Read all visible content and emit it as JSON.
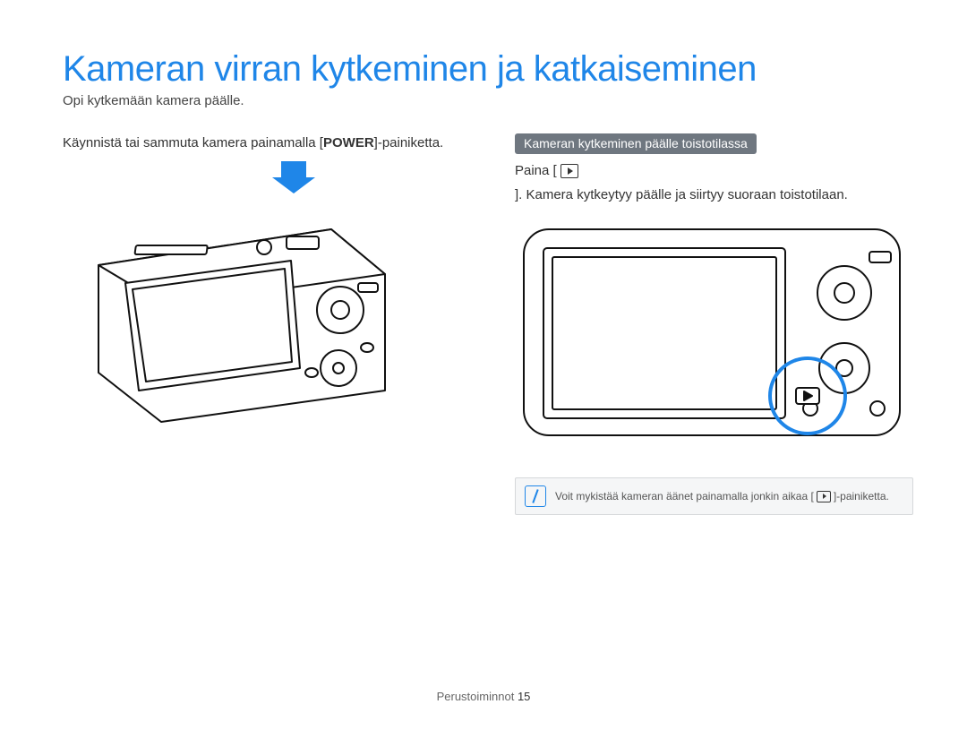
{
  "title": "Kameran virran kytkeminen ja katkaiseminen",
  "subtitle": "Opi kytkemään kamera päälle.",
  "left": {
    "instruction_pre": "Käynnistä tai sammuta kamera painamalla [",
    "power_label": "POWER",
    "instruction_post": "]-painiketta."
  },
  "right": {
    "pill": "Kameran kytkeminen päälle toistotilassa",
    "press_pre": "Paina [",
    "press_post": "]. Kamera kytkeytyy päälle ja siirtyy suoraan toistotilaan.",
    "note_pre": "Voit mykistää kameran äänet painamalla jonkin aikaa [",
    "note_post": "]-painiketta."
  },
  "footer": {
    "section": "Perustoiminnot",
    "page": "15"
  }
}
